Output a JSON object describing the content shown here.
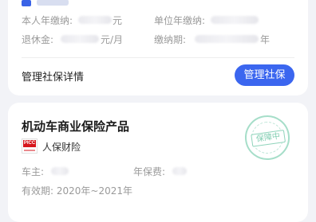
{
  "social_security_card": {
    "personal_annual_label": "本人年缴纳:",
    "personal_annual_unit": "元",
    "employer_annual_label": "单位年缴纳:",
    "pension_label": "退休金:",
    "pension_unit": "元/月",
    "paid_years_label": "缴纳期:",
    "paid_years_unit": "年",
    "details_link": "管理社保详情",
    "manage_button": "管理社保"
  },
  "insurance_card": {
    "product_title": "机动车商业保险产品",
    "logo_text": "PICC",
    "company": "人保财险",
    "stamp_text": "保障中",
    "owner_label": "车主:",
    "premium_label": "年保费:",
    "validity_label": "有效期:",
    "validity_value": "2020年~2021年"
  },
  "colors": {
    "accent": "#3b66ef",
    "stamp": "#8fd4bb",
    "picc_red": "#d6151c"
  }
}
